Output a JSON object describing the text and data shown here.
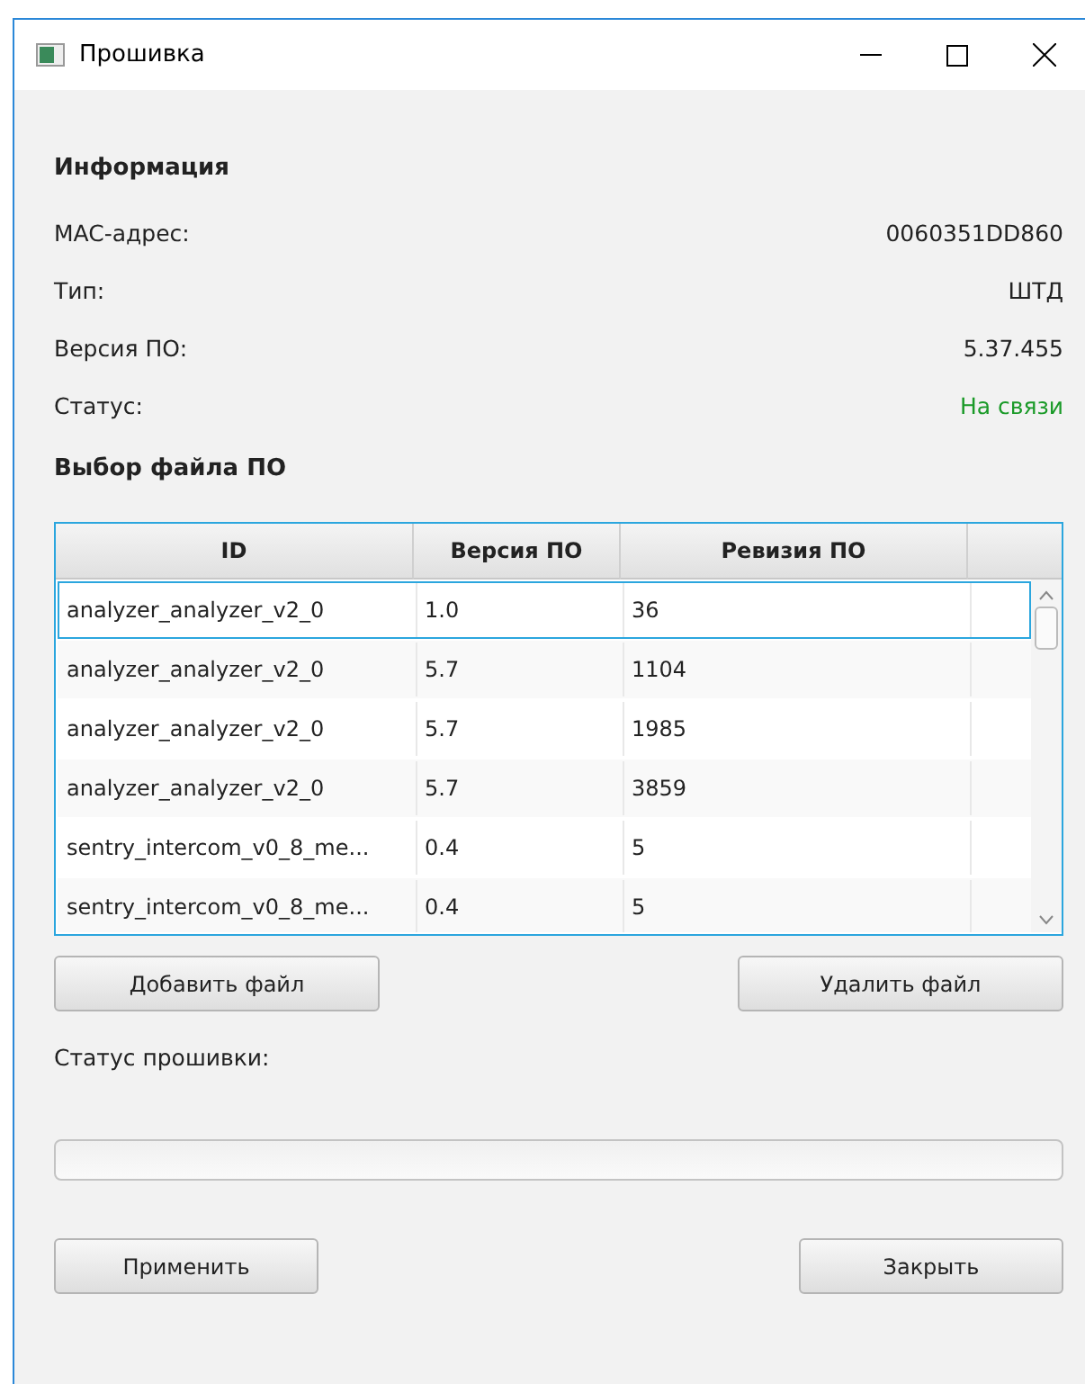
{
  "window": {
    "title": "Прошивка"
  },
  "info": {
    "heading": "Информация",
    "fields": [
      {
        "label": "MAC-адрес:",
        "value": "0060351DD860",
        "kind": "plain"
      },
      {
        "label": "Тип:",
        "value": "ШТД",
        "kind": "plain"
      },
      {
        "label": "Версия ПО:",
        "value": "5.37.455",
        "kind": "plain"
      },
      {
        "label": "Статус:",
        "value": "На связи",
        "kind": "status"
      }
    ]
  },
  "file_section": {
    "heading": "Выбор файла ПО"
  },
  "table": {
    "columns": [
      "ID",
      "Версия ПО",
      "Ревизия ПО"
    ],
    "rows": [
      {
        "cells": [
          "analyzer_analyzer_v2_0",
          "1.0",
          "36"
        ],
        "selected": true
      },
      {
        "cells": [
          "analyzer_analyzer_v2_0",
          "5.7",
          "1104"
        ],
        "selected": false
      },
      {
        "cells": [
          "analyzer_analyzer_v2_0",
          "5.7",
          "1985"
        ],
        "selected": false
      },
      {
        "cells": [
          "analyzer_analyzer_v2_0",
          "5.7",
          "3859"
        ],
        "selected": false
      },
      {
        "cells": [
          "sentry_intercom_v0_8_me...",
          "0.4",
          "5"
        ],
        "selected": false
      },
      {
        "cells": [
          "sentry_intercom_v0_8_me...",
          "0.4",
          "5"
        ],
        "selected": false
      }
    ]
  },
  "file_buttons": [
    "Добавить файл",
    "Удалить файл"
  ],
  "flash_status": {
    "label": "Статус прошивки:",
    "level": 0
  },
  "dialog_buttons": [
    "Применить",
    "Закрыть"
  ]
}
